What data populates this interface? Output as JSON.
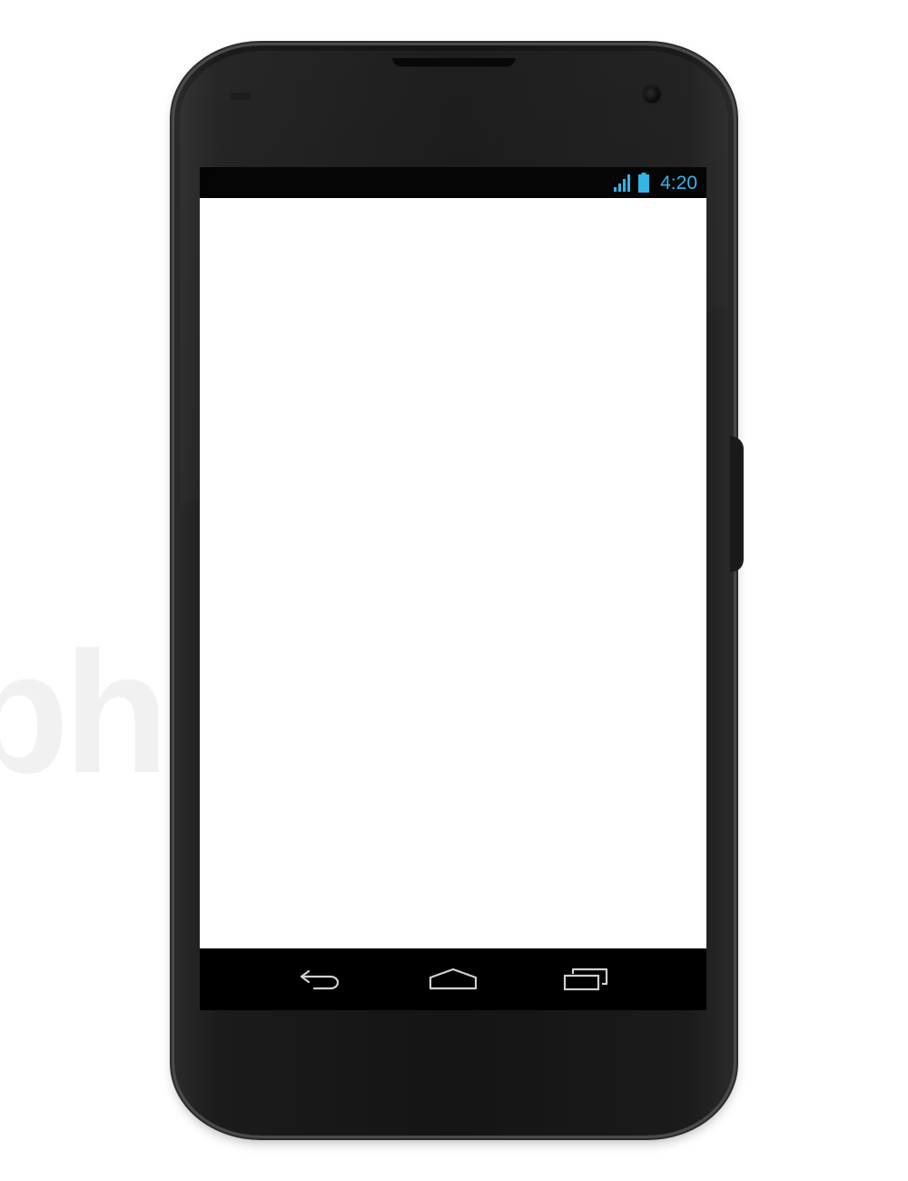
{
  "watermark": {
    "text": "pho"
  },
  "status_bar": {
    "signal_icon": "signal-icon",
    "battery_icon": "battery-icon",
    "clock": "4:20",
    "accent_color": "#33b5e5"
  },
  "nav_bar": {
    "buttons": [
      {
        "icon": "back-icon"
      },
      {
        "icon": "home-icon"
      },
      {
        "icon": "recent-apps-icon"
      }
    ],
    "icon_color": "#d0d0d0"
  },
  "colors": {
    "phone_body": "#141414",
    "screen_content": "#ffffff",
    "status_bar_bg": "#050505",
    "nav_bar_bg": "#000000"
  }
}
